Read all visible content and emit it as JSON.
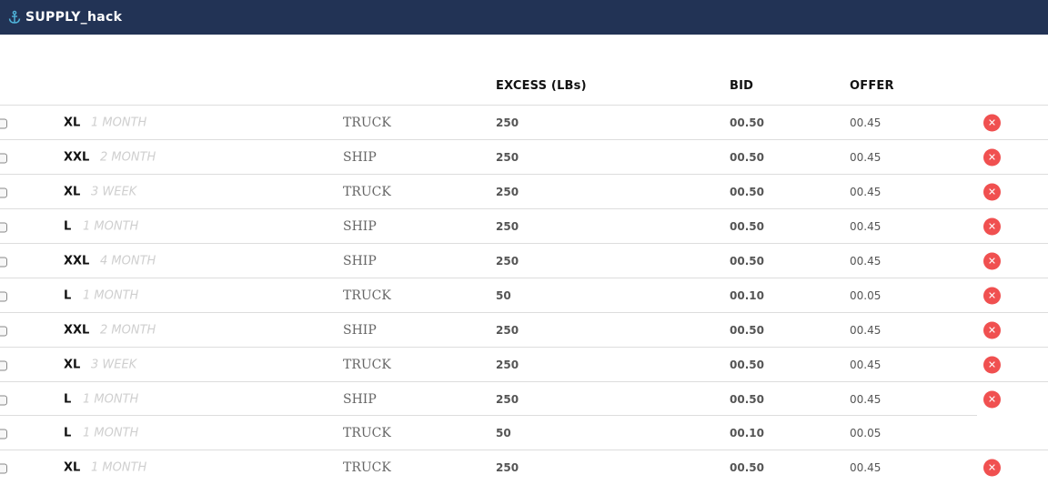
{
  "app": {
    "title": "SUPPLY_hack",
    "logo_icon": "anchor-icon",
    "nav_color": "#223355"
  },
  "table": {
    "columns": {
      "excess": "EXCESS (LBs)",
      "bid": "BID",
      "offer": "OFFER"
    },
    "remove_icon": "close-icon",
    "remove_color": "#f05050",
    "rows": [
      {
        "size": "XL",
        "duration": "1 MONTH",
        "transport": "TRUCK",
        "excess": "250",
        "bid": "00.50",
        "offer": "00.45",
        "removable": true
      },
      {
        "size": "XXL",
        "duration": "2 MONTH",
        "transport": "SHIP",
        "excess": "250",
        "bid": "00.50",
        "offer": "00.45",
        "removable": true
      },
      {
        "size": "XL",
        "duration": "3 WEEK",
        "transport": "TRUCK",
        "excess": "250",
        "bid": "00.50",
        "offer": "00.45",
        "removable": true
      },
      {
        "size": "L",
        "duration": "1 MONTH",
        "transport": "SHIP",
        "excess": "250",
        "bid": "00.50",
        "offer": "00.45",
        "removable": true
      },
      {
        "size": "XXL",
        "duration": "4 MONTH",
        "transport": "SHIP",
        "excess": "250",
        "bid": "00.50",
        "offer": "00.45",
        "removable": true
      },
      {
        "size": "L",
        "duration": "1 MONTH",
        "transport": "TRUCK",
        "excess": "50",
        "bid": "00.10",
        "offer": "00.05",
        "removable": true
      },
      {
        "size": "XXL",
        "duration": "2 MONTH",
        "transport": "SHIP",
        "excess": "250",
        "bid": "00.50",
        "offer": "00.45",
        "removable": true
      },
      {
        "size": "XL",
        "duration": "3 WEEK",
        "transport": "TRUCK",
        "excess": "250",
        "bid": "00.50",
        "offer": "00.45",
        "removable": true
      },
      {
        "size": "L",
        "duration": "1 MONTH",
        "transport": "SHIP",
        "excess": "250",
        "bid": "00.50",
        "offer": "00.45",
        "removable": true
      },
      {
        "size": "L",
        "duration": "1 MONTH",
        "transport": "TRUCK",
        "excess": "50",
        "bid": "00.10",
        "offer": "00.05",
        "removable": false
      },
      {
        "size": "XL",
        "duration": "1 MONTH",
        "transport": "TRUCK",
        "excess": "250",
        "bid": "00.50",
        "offer": "00.45",
        "removable": true
      }
    ]
  }
}
